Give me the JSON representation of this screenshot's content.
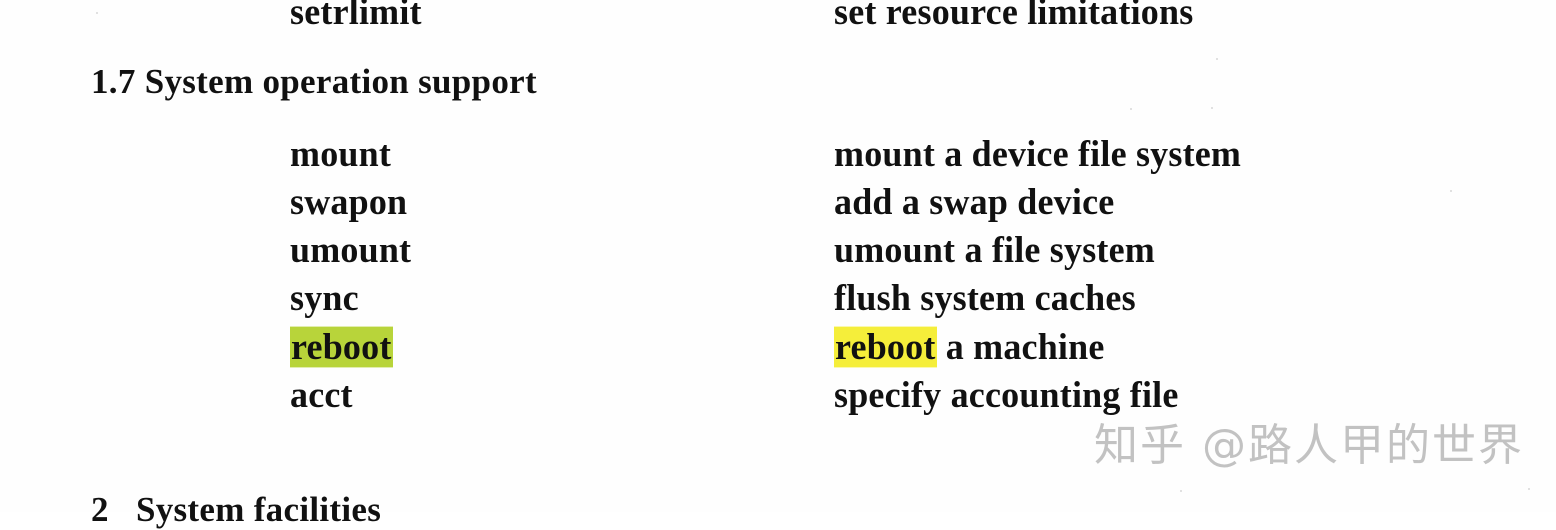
{
  "document": {
    "prev_row": {
      "command": "setrlimit",
      "description": "set resource limitations"
    },
    "section": {
      "heading": "1.7 System operation support",
      "rows": [
        {
          "command": "mount",
          "description_highlight": "",
          "description": "mount a device file system"
        },
        {
          "command": "swapon",
          "description_highlight": "",
          "description": "add a swap device"
        },
        {
          "command": "umount",
          "description_highlight": "",
          "description": "umount a file system"
        },
        {
          "command": "sync",
          "description_highlight": "",
          "description": "flush system caches"
        },
        {
          "command": "reboot",
          "description_highlight": "reboot",
          "description": " a machine"
        },
        {
          "command": "acct",
          "description_highlight": "",
          "description": "specify accounting file"
        }
      ]
    },
    "next_heading": "2   System facilities",
    "highlight_colors": {
      "command": "#b8d43a",
      "description": "#f5ee3a"
    }
  },
  "watermark": {
    "text": "知乎 @路人甲的世界"
  }
}
